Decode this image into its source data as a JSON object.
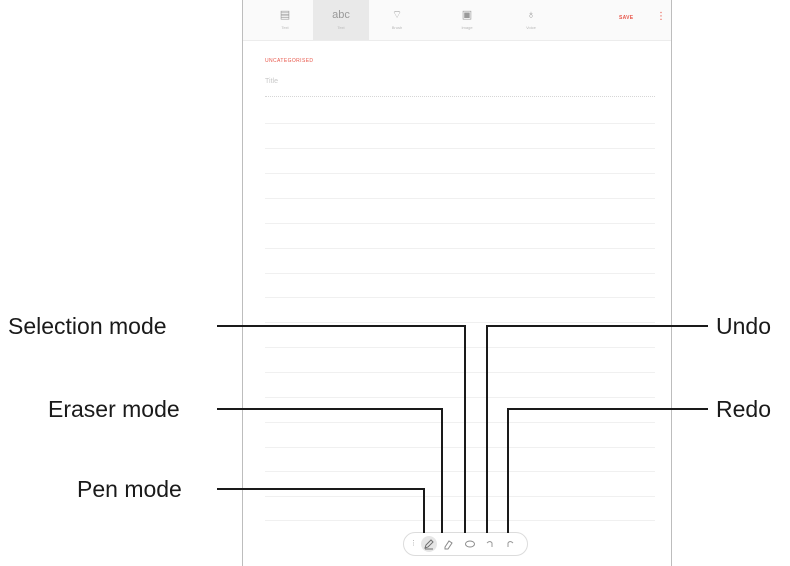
{
  "toolbar": {
    "tools": [
      {
        "icon": "document-icon",
        "glyph": "▤",
        "label": "Text"
      },
      {
        "icon": "text-icon",
        "glyph": "abc",
        "label": "Text"
      },
      {
        "icon": "brush-icon",
        "glyph": "⌔",
        "label": "Brush"
      },
      {
        "icon": "image-icon",
        "glyph": "▣",
        "label": "Image"
      },
      {
        "icon": "microphone-icon",
        "glyph": "♁",
        "label": "Voice"
      }
    ],
    "save_label": "SAVE",
    "more_glyph": "⋮"
  },
  "note": {
    "category": "UNCATEGORISED",
    "title_placeholder": "Title"
  },
  "pen_toolbar": {
    "tools": [
      "pen-mode",
      "eraser-mode",
      "selection-mode",
      "undo",
      "redo"
    ]
  },
  "callouts": {
    "selection_mode": "Selection mode",
    "eraser_mode": "Eraser mode",
    "pen_mode": "Pen mode",
    "undo": "Undo",
    "redo": "Redo"
  },
  "colors": {
    "accent": "#e8564a",
    "leader_line": "#1a1a1a"
  }
}
